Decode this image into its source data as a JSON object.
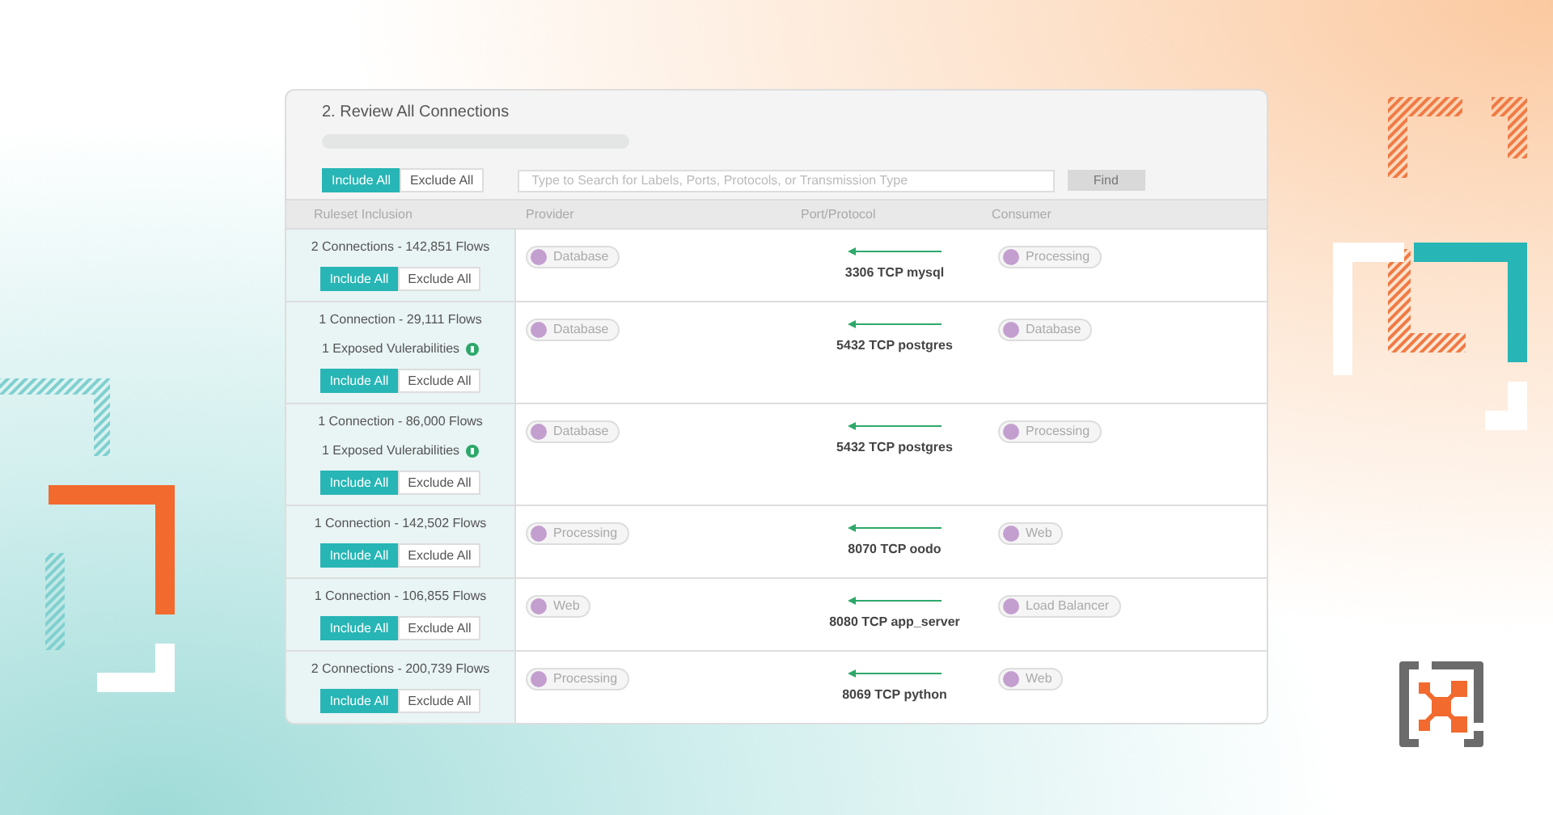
{
  "title": "2. Review All Connections",
  "toolbar": {
    "buttons": [
      {
        "label": "Include All",
        "selected": true
      },
      {
        "label": "Exclude All",
        "selected": false
      }
    ],
    "search": {
      "placeholder": "Type to Search for Labels, Ports, Protocols, or Transmission Type"
    },
    "find": "Find"
  },
  "columns": [
    "Ruleset Inclusion",
    "Provider",
    "Port/Protocol",
    "Consumer"
  ],
  "rows": [
    {
      "summary": "2 Connections - 142,851 Flows",
      "buttons": [
        {
          "label": "Include All",
          "selected": true
        },
        {
          "label": "Exclude All",
          "selected": false
        }
      ],
      "provider": "Database",
      "port": "3306 TCP mysql",
      "consumer": "Processing"
    },
    {
      "summary": "1 Connection - 29,111 Flows",
      "vulnerability": "1 Exposed Vulerabilities",
      "buttons": [
        {
          "label": "Include All",
          "selected": true
        },
        {
          "label": "Exclude All",
          "selected": false
        }
      ],
      "provider": "Database",
      "port": "5432 TCP postgres",
      "consumer": "Database"
    },
    {
      "summary": "1 Connection - 86,000 Flows",
      "vulnerability": "1 Exposed Vulerabilities",
      "buttons": [
        {
          "label": "Include All",
          "selected": true
        },
        {
          "label": "Exclude All",
          "selected": false
        }
      ],
      "provider": "Database",
      "port": "5432 TCP postgres",
      "consumer": "Processing"
    },
    {
      "summary": "1 Connection - 142,502 Flows",
      "buttons": [
        {
          "label": "Include All",
          "selected": true
        },
        {
          "label": "Exclude All",
          "selected": false
        }
      ],
      "provider": "Processing",
      "port": "8070 TCP oodo",
      "consumer": "Web"
    },
    {
      "summary": "1 Connection - 106,855 Flows",
      "buttons": [
        {
          "label": "Include All",
          "selected": true
        },
        {
          "label": "Exclude All",
          "selected": false
        }
      ],
      "provider": "Web",
      "port": "8080 TCP app_server",
      "consumer": "Load Balancer"
    },
    {
      "summary": "2 Connections - 200,739 Flows",
      "buttons": [
        {
          "label": "Include All",
          "selected": true
        },
        {
          "label": "Exclude All",
          "selected": false
        }
      ],
      "provider": "Processing",
      "port": "8069 TCP python",
      "consumer": "Web"
    }
  ]
}
